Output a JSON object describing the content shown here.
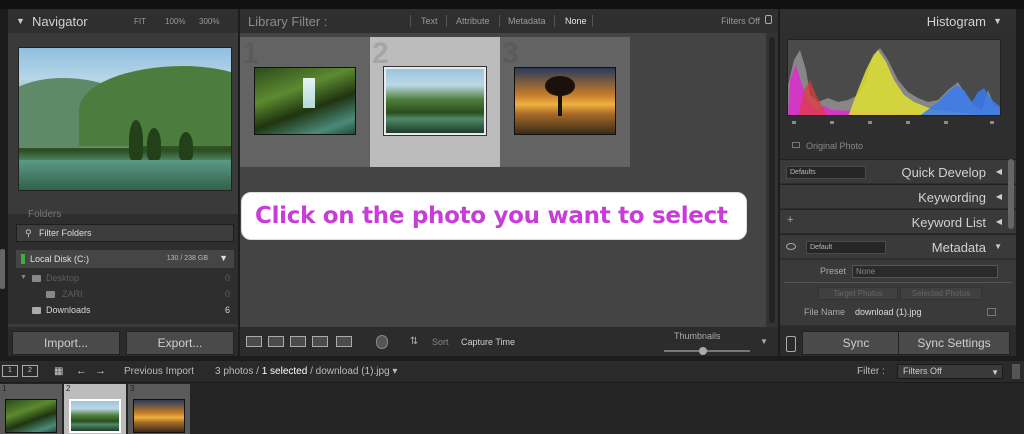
{
  "navigator": {
    "title": "Navigator",
    "zoom_options": [
      "FIT",
      "100%",
      "300%"
    ]
  },
  "folders": {
    "section_title": "Folders",
    "filter_placeholder": "Filter Folders",
    "disk": {
      "name": "Local Disk (C:)",
      "size": "130 / 238 GB"
    },
    "items": [
      {
        "name": "Desktop",
        "count": "0"
      },
      {
        "name": "ZARI",
        "count": "0"
      },
      {
        "name": "Downloads",
        "count": "6"
      }
    ]
  },
  "left_actions": {
    "import_label": "Import...",
    "export_label": "Export..."
  },
  "library_filter": {
    "title": "Library Filter :",
    "tabs": [
      "Text",
      "Attribute",
      "Metadata",
      "None"
    ],
    "active_tab": "None",
    "filters_status": "Filters Off"
  },
  "grid": {
    "cells": [
      {
        "number": "1",
        "selected": false,
        "subject": "waterfall"
      },
      {
        "number": "2",
        "selected": true,
        "subject": "mountain-lake"
      },
      {
        "number": "3",
        "selected": false,
        "subject": "sunset-tree"
      }
    ]
  },
  "callout": {
    "text": "Click on the photo you want to select"
  },
  "bottom_toolbar": {
    "sort_label": "Sort",
    "sort_value": "Capture Time",
    "thumbnails_label": "Thumbnails",
    "thumbnails_level": 0.45
  },
  "histogram": {
    "title": "Histogram",
    "original_photo_label": "Original Photo"
  },
  "right_sections": {
    "quick_develop": {
      "title": "Quick Develop",
      "preset": "Defaults"
    },
    "keywording": {
      "title": "Keywording"
    },
    "keyword_list": {
      "title": "Keyword List"
    },
    "metadata": {
      "title": "Metadata",
      "preset": "Default"
    }
  },
  "metadata_panel": {
    "preset_label": "Preset",
    "preset_value": "None",
    "target_photos_label": "Target Photos",
    "selected_photos_label": "Selected Photos",
    "file_name_label": "File Name",
    "file_name_value": "download (1).jpg"
  },
  "right_actions": {
    "sync_label": "Sync",
    "sync_settings_label": "Sync Settings"
  },
  "filmstrip_bar": {
    "monitor_1": "1",
    "monitor_2": "2",
    "previous_import": "Previous Import",
    "photo_count": "3 photos /",
    "selected_count": "1 selected",
    "current_file": "/ download (1).jpg",
    "filter_label": "Filter :",
    "filter_value": "Filters Off"
  },
  "filmstrip": {
    "cells": [
      {
        "number": "1",
        "selected": false
      },
      {
        "number": "2",
        "selected": true
      },
      {
        "number": "3",
        "selected": false
      }
    ]
  }
}
